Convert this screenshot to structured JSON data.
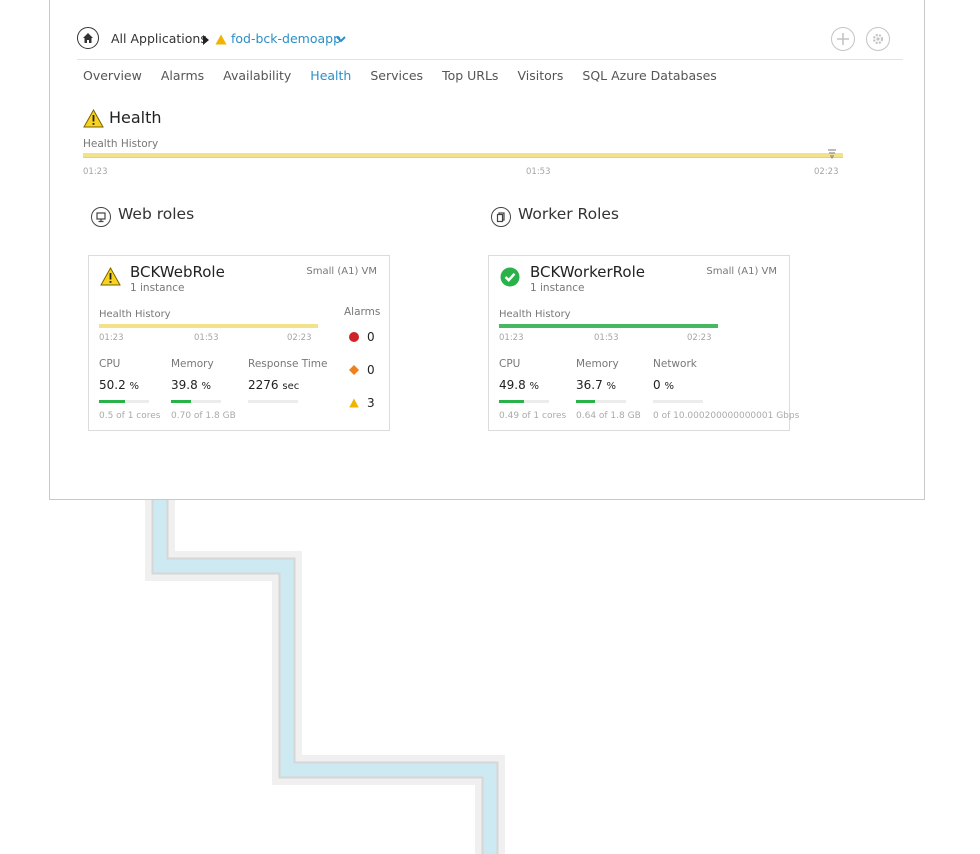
{
  "breadcrumb": {
    "root": "All Applications",
    "app": "fod-bck-demoapp"
  },
  "tabs": [
    "Overview",
    "Alarms",
    "Availability",
    "Health",
    "Services",
    "Top URLs",
    "Visitors",
    "SQL Azure Databases"
  ],
  "active_tab": "Health",
  "health": {
    "title": "Health",
    "history_label": "Health History",
    "ticks": [
      "01:23",
      "01:53",
      "02:23"
    ]
  },
  "web_roles": {
    "title": "Web roles",
    "card": {
      "name": "BCKWebRole",
      "instances": "1 instance",
      "vm_size": "Small (A1) VM",
      "history_label": "Health History",
      "ticks": [
        "01:23",
        "01:53",
        "02:23"
      ],
      "metrics": [
        {
          "label": "CPU",
          "value": "50.2",
          "unit": "%",
          "sub": "0.5 of 1 cores",
          "fill": 0.5
        },
        {
          "label": "Memory",
          "value": "39.8",
          "unit": "%",
          "sub": "0.70 of 1.8 GB",
          "fill": 0.4
        },
        {
          "label": "Response Time",
          "value": "2276",
          "unit": "sec",
          "sub": "",
          "fill": 0
        }
      ],
      "alarms_label": "Alarms",
      "alarms": {
        "critical": "0",
        "major": "0",
        "warning": "3"
      }
    }
  },
  "worker_roles": {
    "title": "Worker Roles",
    "card": {
      "name": "BCKWorkerRole",
      "instances": "1 instance",
      "vm_size": "Small (A1) VM",
      "history_label": "Health History",
      "ticks": [
        "01:23",
        "01:53",
        "02:23"
      ],
      "metrics": [
        {
          "label": "CPU",
          "value": "49.8",
          "unit": "%",
          "sub": "0.49 of 1 cores",
          "fill": 0.5
        },
        {
          "label": "Memory",
          "value": "36.7",
          "unit": "%",
          "sub": "0.64 of 1.8 GB",
          "fill": 0.37
        },
        {
          "label": "Network",
          "value": "0",
          "unit": "%",
          "sub": "0 of 10.000200000000001 Gbps",
          "fill": 0
        }
      ]
    }
  },
  "colors": {
    "accent": "#2b8fc7",
    "warning": "#f0b400",
    "ok": "#2ab24a",
    "critical": "#d0212a",
    "major": "#f07f1d"
  }
}
